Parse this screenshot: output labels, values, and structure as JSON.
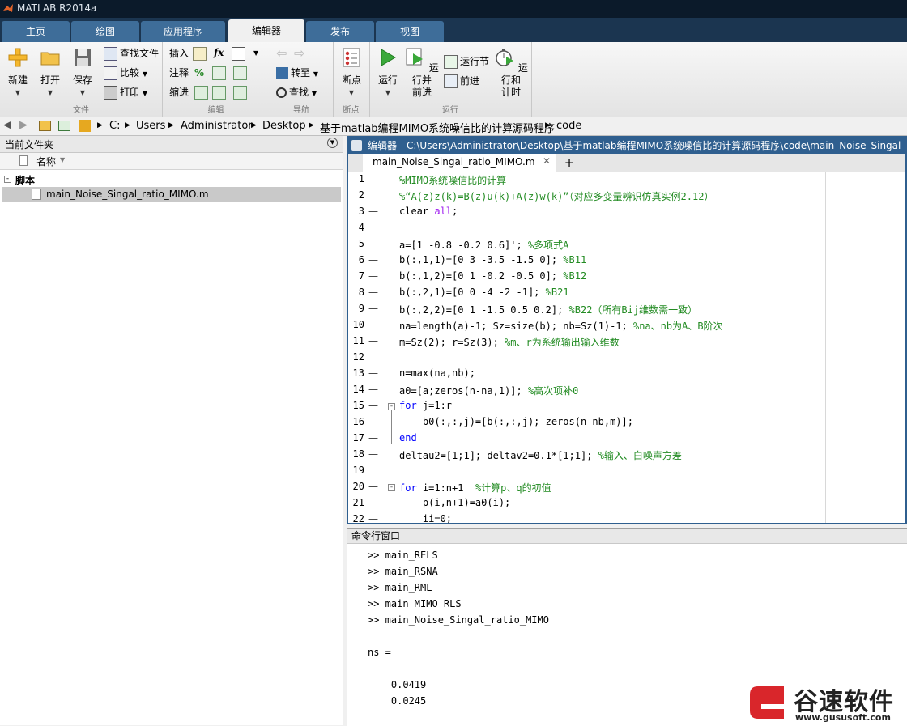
{
  "window": {
    "title": "MATLAB R2014a"
  },
  "tabs": [
    "主页",
    "绘图",
    "应用程序",
    "编辑器",
    "发布",
    "视图"
  ],
  "active_tab": "编辑器",
  "ribbon": {
    "file": {
      "new": "新建",
      "open": "打开",
      "save": "保存",
      "find_files": "查找文件",
      "compare": "比较",
      "print": "打印",
      "label": "文件"
    },
    "edit": {
      "insert": "插入",
      "comment": "注释",
      "indent": "缩进",
      "fx": "fx",
      "percent": "%",
      "label": "编辑"
    },
    "navigate": {
      "goto": "转至",
      "find": "查找",
      "label": "导航"
    },
    "breakpoints": {
      "breakpoint": "断点",
      "label": "断点"
    },
    "run": {
      "run": "运行",
      "run_advance_1": "运行并",
      "run_advance_2": "前进",
      "run_section": "运行节",
      "advance": "前进",
      "run_time_1": "运行和",
      "run_time_2": "计时",
      "label": "运行"
    }
  },
  "address": [
    "C:",
    "Users",
    "Administrator",
    "Desktop",
    "基于matlab编程MIMO系统噪信比的计算源码程序",
    "code"
  ],
  "current_folder": {
    "title": "当前文件夹",
    "col_name": "名称",
    "group": "脚本",
    "file": "main_Noise_Singal_ratio_MIMO.m"
  },
  "editor": {
    "title": "编辑器 - C:\\Users\\Administrator\\Desktop\\基于matlab编程MIMO系统噪信比的计算源码程序\\code\\main_Noise_Singal_ratio_MIMO.m",
    "tab": "main_Noise_Singal_ratio_MIMO.m",
    "add_tab": "+",
    "lines": [
      {
        "n": "1",
        "dash": false,
        "parts": [
          {
            "t": "%MIMO系统噪信比的计算",
            "c": "cm"
          }
        ]
      },
      {
        "n": "2",
        "dash": false,
        "parts": [
          {
            "t": "%“A(z)z(k)=B(z)u(k)+A(z)w(k)”（对应多变量辨识仿真实例2.12）",
            "c": "cm"
          }
        ]
      },
      {
        "n": "3",
        "dash": true,
        "parts": [
          {
            "t": "clear ",
            "c": ""
          },
          {
            "t": "all",
            "c": "str"
          },
          {
            "t": ";",
            "c": ""
          }
        ]
      },
      {
        "n": "4",
        "dash": false,
        "parts": []
      },
      {
        "n": "5",
        "dash": true,
        "parts": [
          {
            "t": "a=[1 -0.8 -0.2 0.6]'; ",
            "c": ""
          },
          {
            "t": "%多项式A",
            "c": "cm"
          }
        ]
      },
      {
        "n": "6",
        "dash": true,
        "parts": [
          {
            "t": "b(:,1,1)=[0 3 -3.5 -1.5 0]; ",
            "c": ""
          },
          {
            "t": "%B11",
            "c": "cm"
          }
        ]
      },
      {
        "n": "7",
        "dash": true,
        "parts": [
          {
            "t": "b(:,1,2)=[0 1 -0.2 -0.5 0]; ",
            "c": ""
          },
          {
            "t": "%B12",
            "c": "cm"
          }
        ]
      },
      {
        "n": "8",
        "dash": true,
        "parts": [
          {
            "t": "b(:,2,1)=[0 0 -4 -2 -1]; ",
            "c": ""
          },
          {
            "t": "%B21",
            "c": "cm"
          }
        ]
      },
      {
        "n": "9",
        "dash": true,
        "parts": [
          {
            "t": "b(:,2,2)=[0 1 -1.5 0.5 0.2]; ",
            "c": ""
          },
          {
            "t": "%B22（所有Bij维数需一致）",
            "c": "cm"
          }
        ]
      },
      {
        "n": "10",
        "dash": true,
        "parts": [
          {
            "t": "na=length(a)-1; Sz=size(b); nb=Sz(1)-1; ",
            "c": ""
          },
          {
            "t": "%na、nb为A、B阶次",
            "c": "cm"
          }
        ]
      },
      {
        "n": "11",
        "dash": true,
        "parts": [
          {
            "t": "m=Sz(2); r=Sz(3); ",
            "c": ""
          },
          {
            "t": "%m、r为系统输出输入维数",
            "c": "cm"
          }
        ]
      },
      {
        "n": "12",
        "dash": false,
        "parts": []
      },
      {
        "n": "13",
        "dash": true,
        "parts": [
          {
            "t": "n=max(na,nb);",
            "c": ""
          }
        ]
      },
      {
        "n": "14",
        "dash": true,
        "parts": [
          {
            "t": "a0=[a;zeros(n-na,1)]; ",
            "c": ""
          },
          {
            "t": "%高次项补0",
            "c": "cm"
          }
        ]
      },
      {
        "n": "15",
        "dash": true,
        "parts": [
          {
            "t": "for",
            "c": "kw"
          },
          {
            "t": " j=1:r",
            "c": ""
          }
        ]
      },
      {
        "n": "16",
        "dash": true,
        "parts": [
          {
            "t": "    b0(:,:,j)=[b(:,:,j); zeros(n-nb,m)];",
            "c": ""
          }
        ]
      },
      {
        "n": "17",
        "dash": true,
        "parts": [
          {
            "t": "end",
            "c": "kw"
          }
        ]
      },
      {
        "n": "18",
        "dash": true,
        "parts": [
          {
            "t": "deltau2=[1;1]; deltav2=0.1*[1;1]; ",
            "c": ""
          },
          {
            "t": "%输入、白噪声方差",
            "c": "cm"
          }
        ]
      },
      {
        "n": "19",
        "dash": false,
        "parts": []
      },
      {
        "n": "20",
        "dash": true,
        "parts": [
          {
            "t": "for",
            "c": "kw"
          },
          {
            "t": " i=1:n+1  ",
            "c": ""
          },
          {
            "t": "%计算p、q的初值",
            "c": "cm"
          }
        ]
      },
      {
        "n": "21",
        "dash": true,
        "parts": [
          {
            "t": "    p(i,n+1)=a0(i);",
            "c": ""
          }
        ]
      },
      {
        "n": "22",
        "dash": true,
        "parts": [
          {
            "t": "    ii=0;",
            "c": ""
          }
        ]
      }
    ]
  },
  "command_window": {
    "title": "命令行窗口",
    "lines": [
      ">> main_RELS",
      ">> main_RSNA",
      ">> main_RML",
      ">> main_MIMO_RLS",
      ">> main_Noise_Singal_ratio_MIMO",
      "",
      "ns =",
      "",
      "    0.0419",
      "    0.0245"
    ]
  },
  "watermark": {
    "brand": "谷速软件",
    "url": "www.gususoft.com"
  },
  "colors": {
    "accent": "#2f5f8f",
    "comment": "#228b22",
    "keyword": "#0000ff",
    "string": "#a020f0"
  }
}
